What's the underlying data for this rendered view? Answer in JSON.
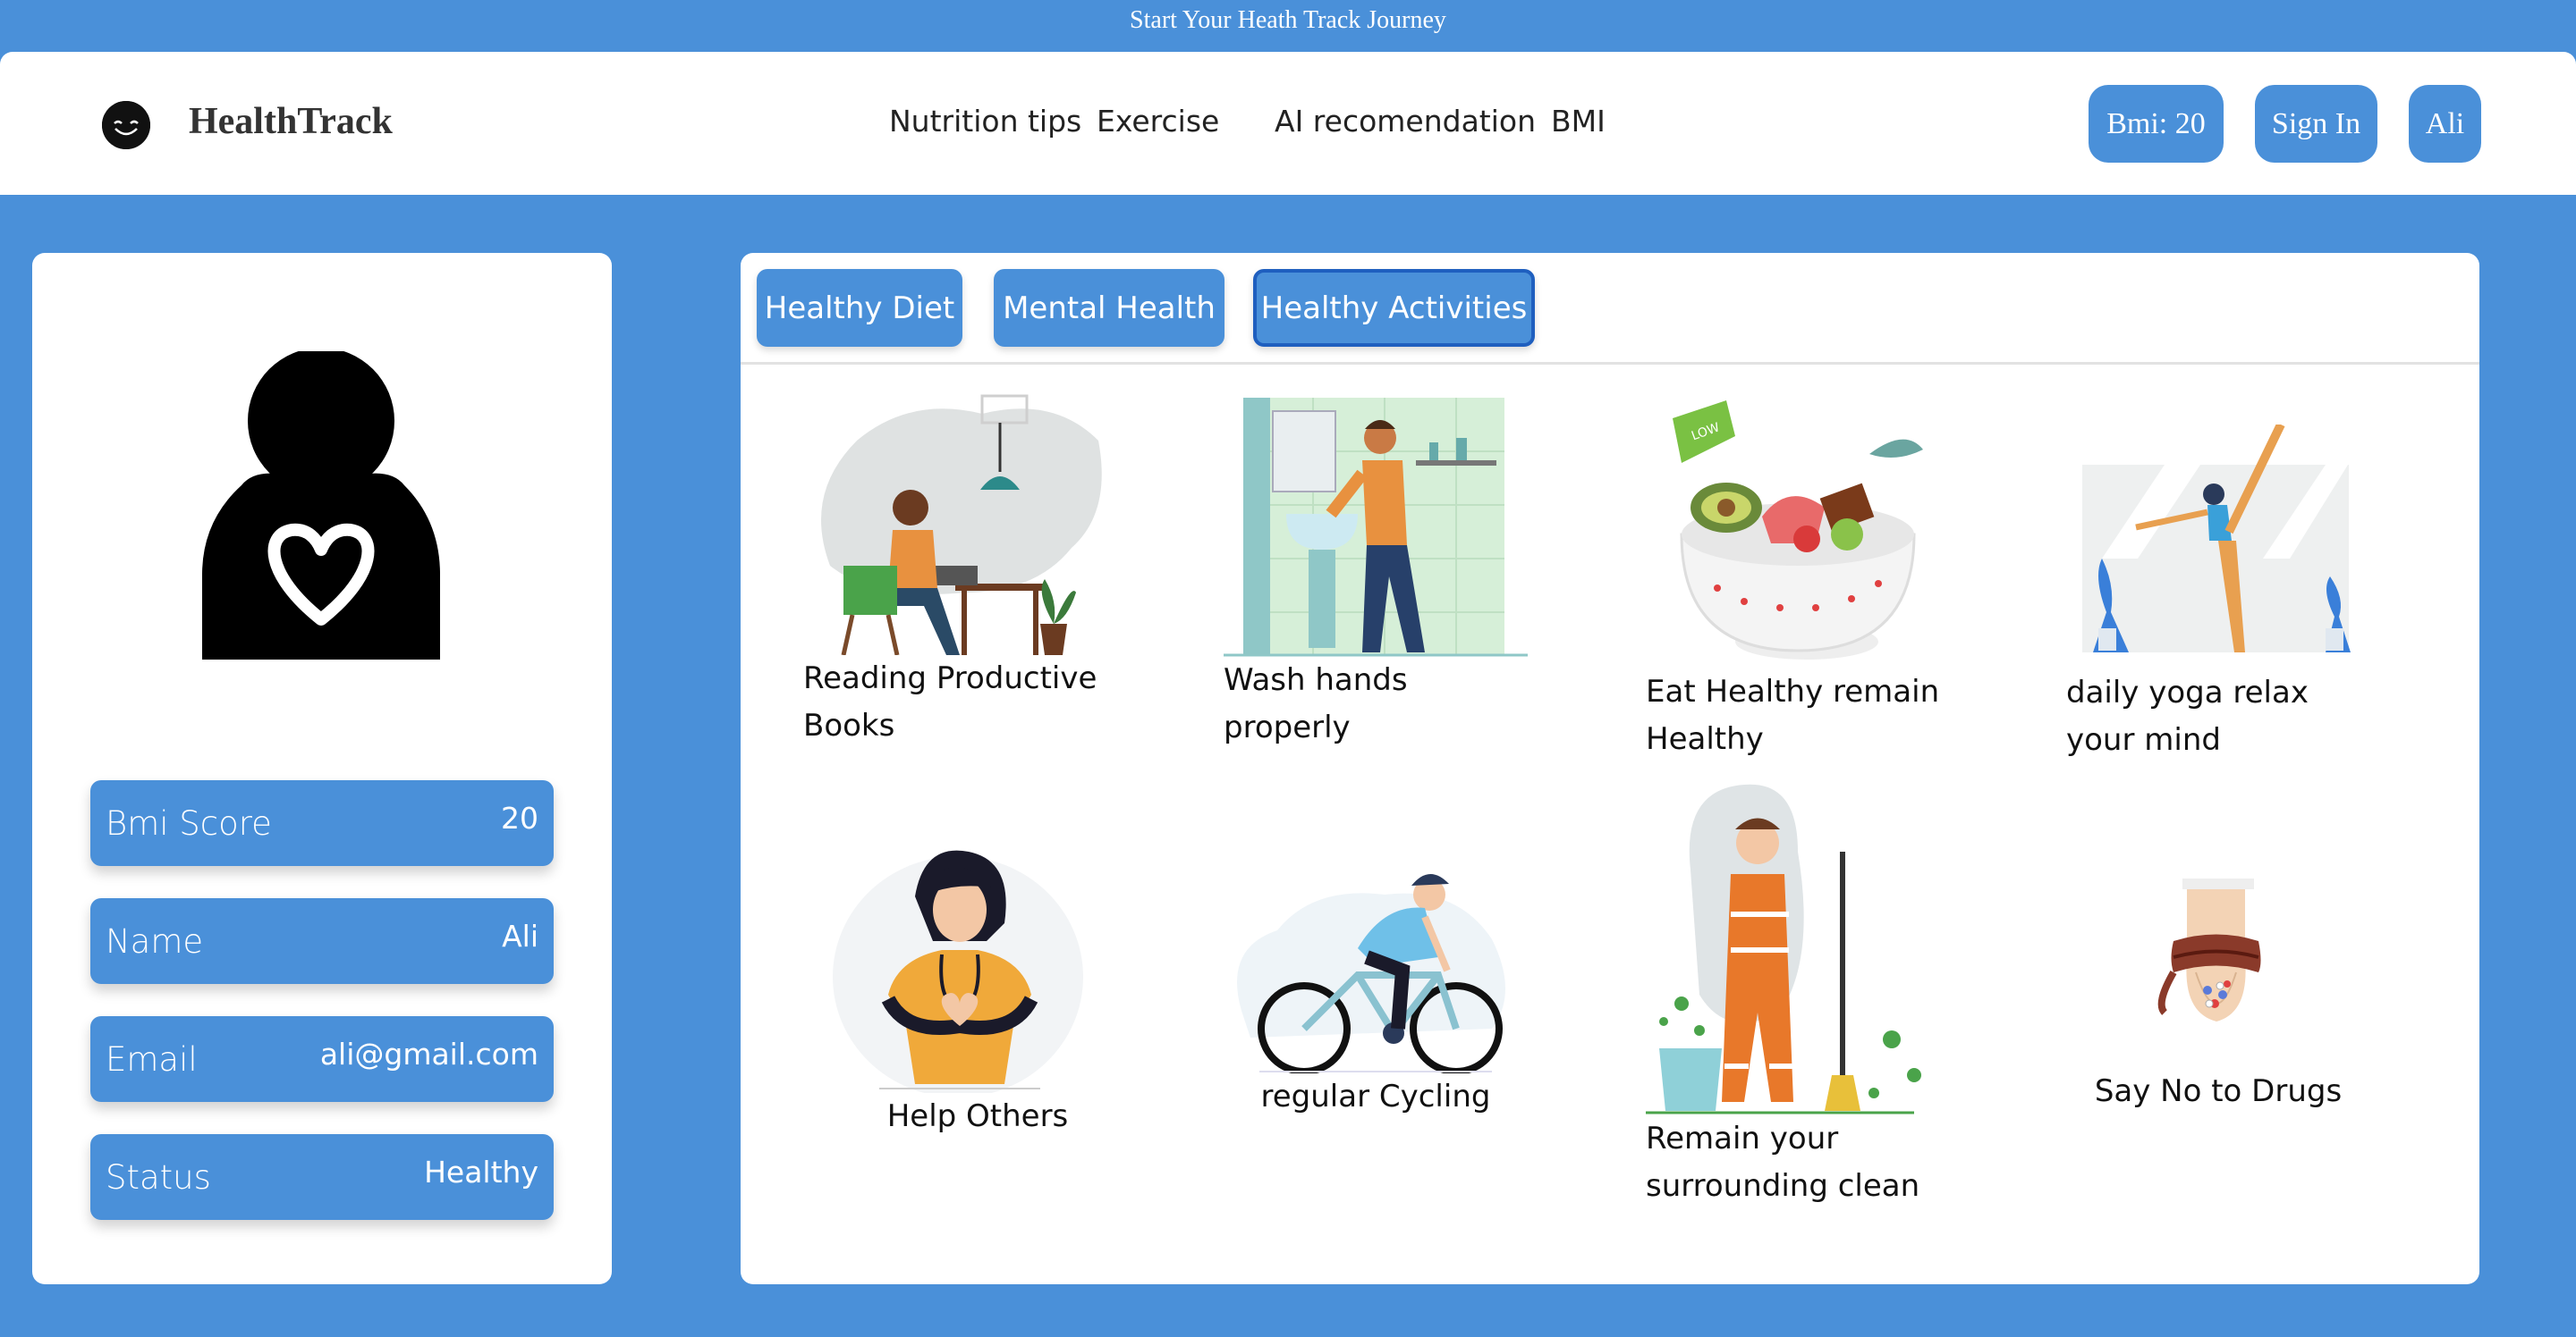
{
  "banner": {
    "text": "Start Your Heath Track Journey"
  },
  "header": {
    "logo_icon": "smiley-face-icon",
    "brand": "HealthTrack",
    "nav": [
      "Nutrition tips",
      "Exercise",
      "AI recomendation",
      "BMI"
    ],
    "bmi_button": "Bmi: 20",
    "signin_button": "Sign In",
    "user_button": "Ali"
  },
  "profile": {
    "avatar_icon": "person-heart-icon",
    "rows": [
      {
        "label": "Bmi Score",
        "value": "20"
      },
      {
        "label": "Name",
        "value": "Ali"
      },
      {
        "label": "Email",
        "value": "ali@gmail.com"
      },
      {
        "label": "Status",
        "value": "Healthy"
      }
    ]
  },
  "tabs": [
    {
      "label": "Healthy Diet",
      "active": false
    },
    {
      "label": "Mental Health",
      "active": false
    },
    {
      "label": "Healthy Activities",
      "active": true
    }
  ],
  "activities": [
    {
      "caption": "Reading Productive Books",
      "icon": "reading-person-illustration"
    },
    {
      "caption": "Wash hands properly",
      "icon": "washing-hands-illustration"
    },
    {
      "caption": "Eat Healthy remain Healthy",
      "icon": "healthy-salad-bowl-illustration"
    },
    {
      "caption": "daily yoga relax your mind",
      "icon": "yoga-pose-illustration"
    },
    {
      "caption": "Help Others",
      "icon": "nurse-heart-hands-illustration"
    },
    {
      "caption": "regular Cycling",
      "icon": "cyclist-illustration"
    },
    {
      "caption": "Remain your surrounding clean",
      "icon": "sweeper-cleaning-illustration"
    },
    {
      "caption": "Say No to Drugs",
      "icon": "tied-hands-pills-illustration"
    }
  ],
  "colors": {
    "primary": "#4a90d9",
    "active_tab_border": "#1f5fbf",
    "card": "#ffffff"
  }
}
